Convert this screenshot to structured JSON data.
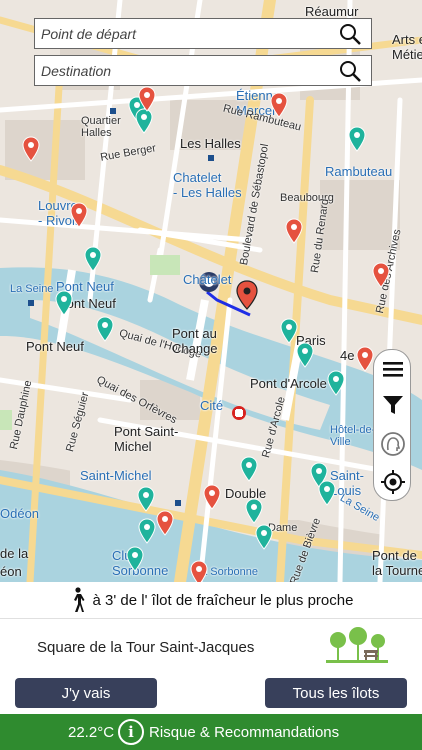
{
  "search": {
    "start_placeholder": "Point de départ",
    "destination_placeholder": "Destination"
  },
  "map": {
    "labels": {
      "reaumur": "Réaumur",
      "arts_metiers": "Arts e\nMétier",
      "etienne_marcel": "Étienne\nMarcel",
      "quartier_halles": "Quartier\nHalles",
      "les_halles": "Les Halles",
      "rambuteau": "Rambuteau",
      "rue_rambuteau": "Rue Rambuteau",
      "rue_berger": "Rue Berger",
      "chatelet_les_halles": "Chatelet\n- Les Halles",
      "beaubourg": "Beaubourg",
      "louvre_rivoli": "Louvre\n- Rivoli",
      "bd_sebastopol": "Boulevard de Sébastopol",
      "rue_renard": "Rue du Renard",
      "rue_archives": "Rue des Archives",
      "chatelet": "Châtelet",
      "la_seine_1": "La Seine",
      "pont_neuf_metro": "Pont Neuf",
      "pont_neuf": "Pont Neuf",
      "quai_horloge": "Quai de l'Horloge",
      "pont_au_change": "Pont au\nChange",
      "paris": "Paris",
      "arr_4": "4e",
      "pont_arcole": "Pont d'Arcole",
      "cite": "Cité",
      "rue_arcole": "Rue d'Arcole",
      "hotel_ville": "Hôtel-de-\nVille",
      "pont_saint_michel": "Pont Saint-\nMichel",
      "saint_michel": "Saint-Michel",
      "quai_orfevres": "Quai des Orfèvres",
      "rue_seguier": "Rue Séguier",
      "rue_dauphine": "Rue Dauphine",
      "saint_louis": "Saint-\nLouis",
      "double": "Double",
      "notre_dame": "Dame",
      "odeon": "Odéon",
      "cluny": "Clu\nSorbonne",
      "la_sorbonne": "La Sorbonne",
      "la_seine_2": "La Seine",
      "pont_tournelle": "Pont de\nla Tournell",
      "rue_bievre": "Rue de Bièvre",
      "de_la": "de la",
      "eon": "éon"
    },
    "colors": {
      "pin_teal": "#1fb39c",
      "pin_red": "#e5523f",
      "route": "#1f2ee6",
      "river": "#aad3df"
    }
  },
  "controls": {
    "menu": "menu-icon",
    "filter": "filter-icon",
    "location": "location-icon"
  },
  "info": {
    "walk_text": "à 3' de l' îlot de fraîcheur le plus proche"
  },
  "place": {
    "name": "Square de la Tour Saint-Jacques"
  },
  "buttons": {
    "go": "J'y vais",
    "all": "Tous les îlots"
  },
  "footer": {
    "temperature": "22.2°C",
    "risk": "Risque & Recommandations"
  }
}
